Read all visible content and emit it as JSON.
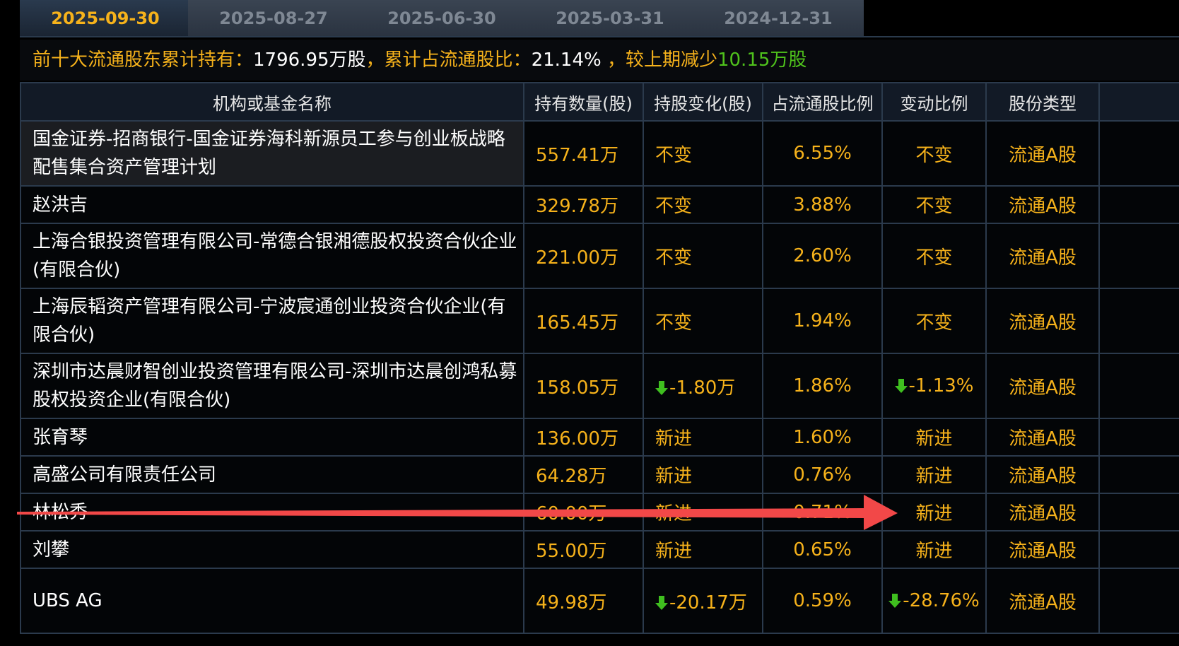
{
  "tabs": [
    {
      "label": "2025-09-30",
      "active": true
    },
    {
      "label": "2025-08-27",
      "active": false
    },
    {
      "label": "2025-06-30",
      "active": false
    },
    {
      "label": "2025-03-31",
      "active": false
    },
    {
      "label": "2024-12-31",
      "active": false
    }
  ],
  "summary": {
    "label1": "前十大流通股东累计持有：",
    "value1": "1796.95万股",
    "label2": "，累计占流通股比：",
    "value2": "21.14%",
    "label3": " ，较上期减少",
    "value3": "10.15万股"
  },
  "table": {
    "headers": [
      "机构或基金名称",
      "持有数量(股)",
      "持股变化(股)",
      "占流通股比例",
      "变动比例",
      "股份类型"
    ],
    "rows": [
      {
        "name": "国金证券-招商银行-国金证券海科新源员工参与创业板战略配售集合资产管理计划",
        "qty": "557.41万",
        "change": "不变",
        "pct": "6.55%",
        "ratio": "不变",
        "type": "流通A股"
      },
      {
        "name": "赵洪吉",
        "qty": "329.78万",
        "change": "不变",
        "pct": "3.88%",
        "ratio": "不变",
        "type": "流通A股"
      },
      {
        "name": "上海合银投资管理有限公司-常德合银湘德股权投资合伙企业(有限合伙)",
        "qty": "221.00万",
        "change": "不变",
        "pct": "2.60%",
        "ratio": "不变",
        "type": "流通A股"
      },
      {
        "name": "上海辰韬资产管理有限公司-宁波宸通创业投资合伙企业(有限合伙)",
        "qty": "165.45万",
        "change": "不变",
        "pct": "1.94%",
        "ratio": "不变",
        "type": "流通A股"
      },
      {
        "name": "深圳市达晨财智创业投资管理有限公司-深圳市达晨创鸿私募股权投资企业(有限合伙)",
        "qty": "158.05万",
        "change": "-1.80万",
        "pct": "1.86%",
        "ratio": "-1.13%",
        "type": "流通A股"
      },
      {
        "name": "张育琴",
        "qty": "136.00万",
        "change": "新进",
        "pct": "1.60%",
        "ratio": "新进",
        "type": "流通A股"
      },
      {
        "name": "高盛公司有限责任公司",
        "qty": "64.28万",
        "change": "新进",
        "pct": "0.76%",
        "ratio": "新进",
        "type": "流通A股"
      },
      {
        "name": "林松秀",
        "qty": "60.00万",
        "change": "新进",
        "pct": "0.71%",
        "ratio": "新进",
        "type": "流通A股"
      },
      {
        "name": "刘攀",
        "qty": "55.00万",
        "change": "新进",
        "pct": "0.65%",
        "ratio": "新进",
        "type": "流通A股"
      },
      {
        "name": "UBS AG",
        "qty": "49.98万",
        "change": "-20.17万",
        "pct": "0.59%",
        "ratio": "-28.76%",
        "type": "流通A股"
      }
    ]
  },
  "colors": {
    "accent": "#f6b21b",
    "new": "#ff2a2a",
    "decrease": "#3fbf1f",
    "annotation_arrow": "#f24848"
  }
}
